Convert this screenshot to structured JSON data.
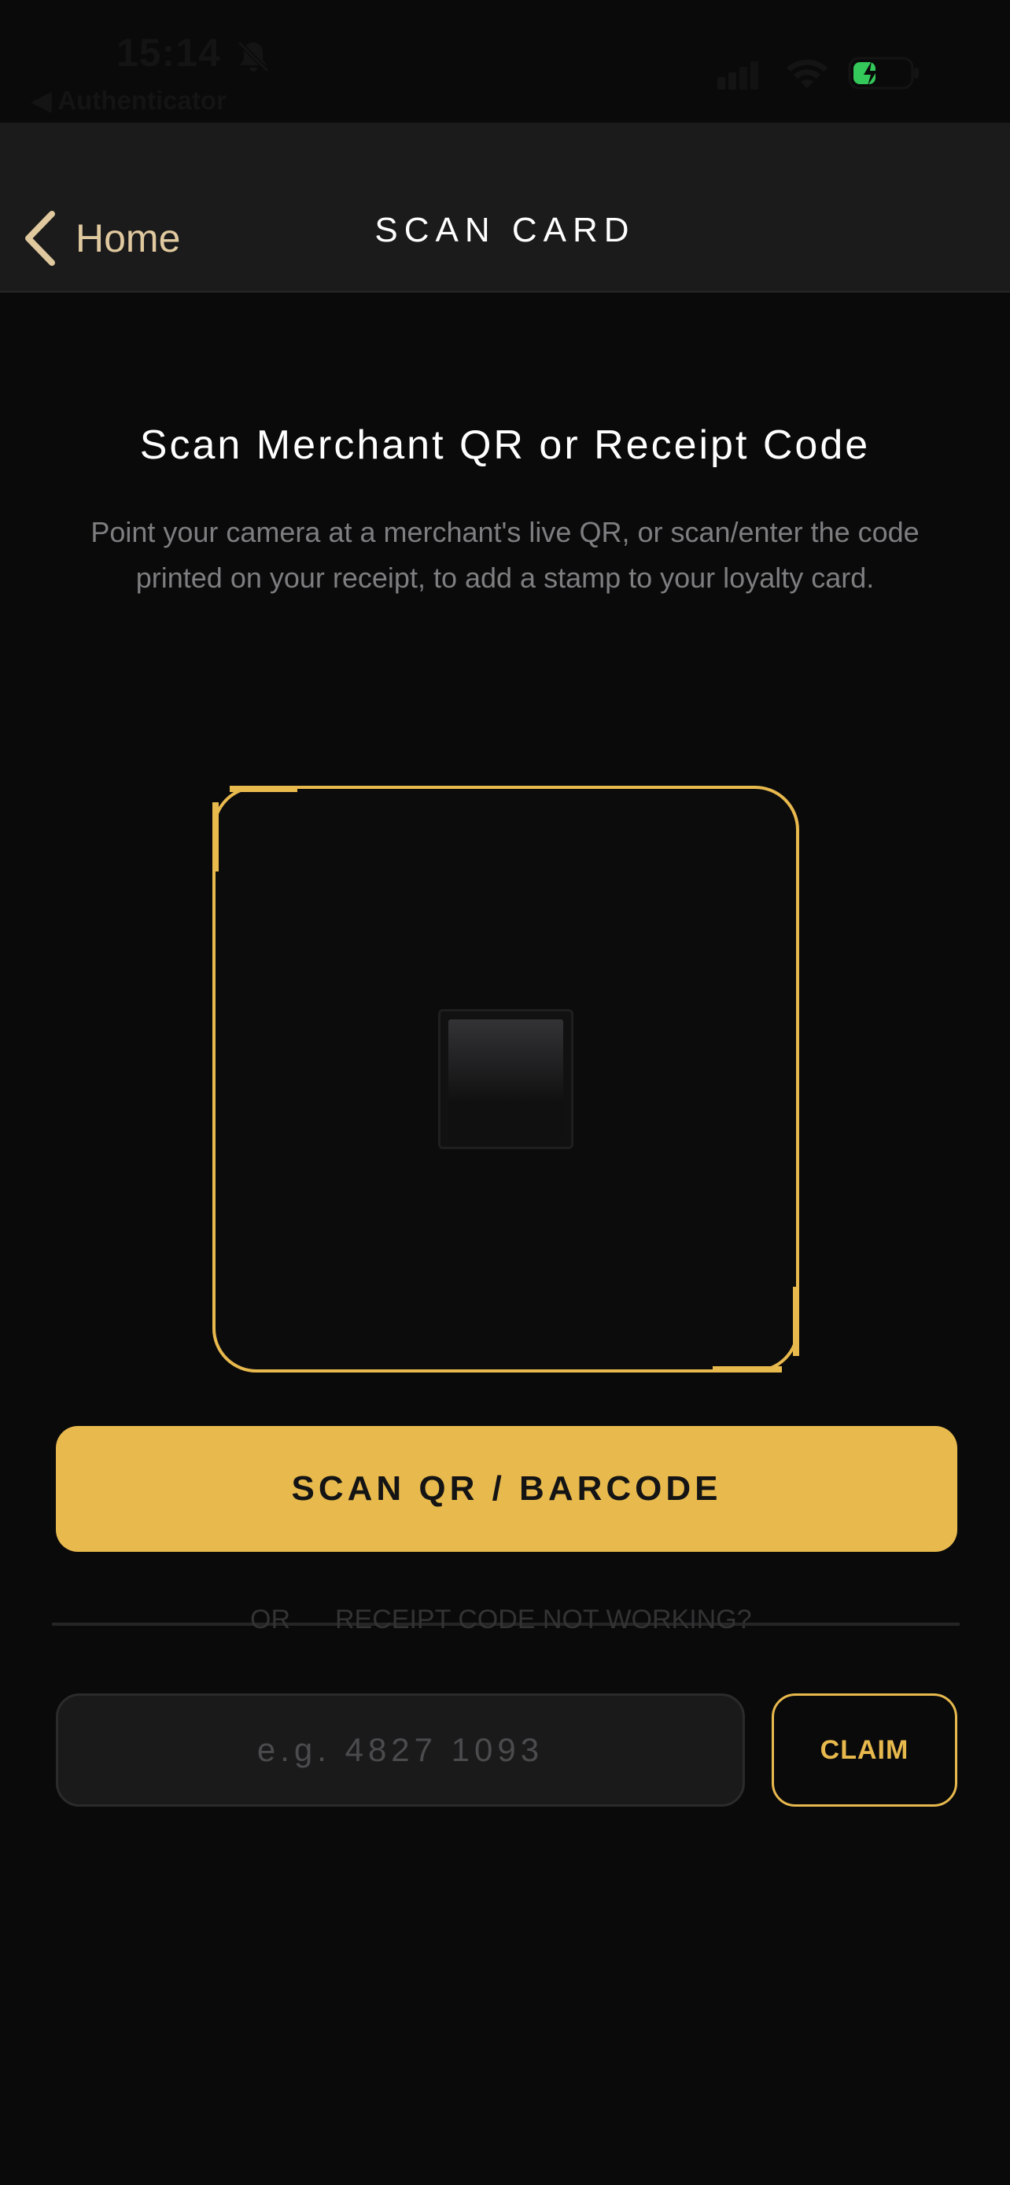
{
  "status_bar": {
    "time": "15:14",
    "back_app": "◀ Authenticator",
    "icons": [
      "bell-slash-icon",
      "signal-icon",
      "wifi-icon",
      "battery-charging-icon"
    ],
    "battery_color": "#34c759"
  },
  "nav": {
    "back_label": "Home",
    "title": "SCAN CARD"
  },
  "content": {
    "title": "Scan Merchant QR or Receipt Code",
    "description": "Point your camera at a merchant's live QR, or scan/enter the code printed on your receipt, to add a stamp to your loyalty card."
  },
  "scan_button": {
    "label": "SCAN QR / BARCODE"
  },
  "divider": {
    "or_label": "OR",
    "link_label": "RECEIPT CODE NOT WORKING?"
  },
  "code_entry": {
    "placeholder": "e.g. 4827 1093",
    "value": "",
    "claim_label": "CLAIM"
  },
  "colors": {
    "accent": "#e8b94d",
    "background": "#0a0a0b",
    "nav_background": "#1b1b1c",
    "back_label": "#e0c99e",
    "muted_text": "#7e7e80"
  }
}
